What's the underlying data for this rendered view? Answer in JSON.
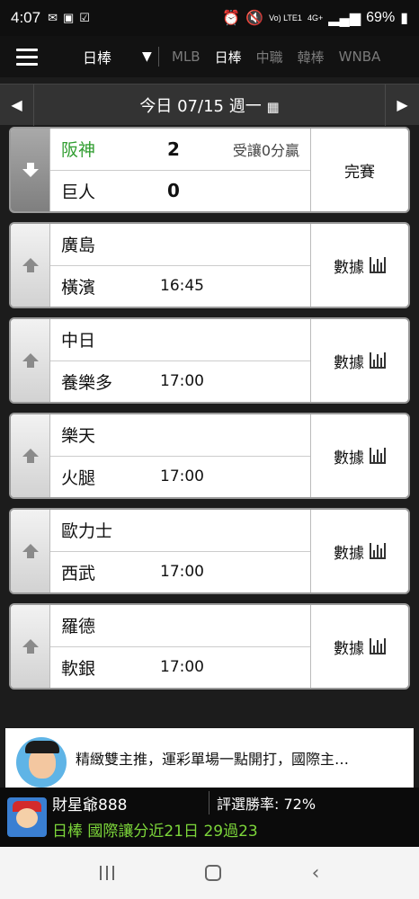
{
  "status_bar": {
    "time": "4:07",
    "battery": "69%",
    "network": "4G+",
    "volte": "Vo) LTE1"
  },
  "nav": {
    "selected": "日棒",
    "caret": "▼",
    "tabs": [
      "MLB",
      "日棒",
      "中職",
      "韓棒",
      "WNBA"
    ],
    "active_tab": "日棒"
  },
  "date_bar": {
    "label": "今日 07/15 週一",
    "calendar_icon": "📅",
    "prev": "◀",
    "next": "▶"
  },
  "games": [
    {
      "home": "阪神",
      "away": "巨人",
      "home_score": "2",
      "away_score": "0",
      "note": "受讓0分贏",
      "status": "完賽",
      "winner": "home",
      "time": ""
    },
    {
      "home": "廣島",
      "away": "橫濱",
      "time": "16:45",
      "status": "數據"
    },
    {
      "home": "中日",
      "away": "養樂多",
      "time": "17:00",
      "status": "數據"
    },
    {
      "home": "樂天",
      "away": "火腿",
      "time": "17:00",
      "status": "數據"
    },
    {
      "home": "歐力士",
      "away": "西武",
      "time": "17:00",
      "status": "數據"
    },
    {
      "home": "羅德",
      "away": "軟銀",
      "time": "17:00",
      "status": "數據"
    }
  ],
  "ad": {
    "text": "精緻雙主推，運彩單場一點開打，國際主…"
  },
  "expert": {
    "name": "財星爺888",
    "win_rate": "評選勝率: 72%",
    "record": "日棒 國際讓分近21日 29過23"
  },
  "colors": {
    "winner_green": "#2f9d2f",
    "record_green": "#7cd63a"
  }
}
